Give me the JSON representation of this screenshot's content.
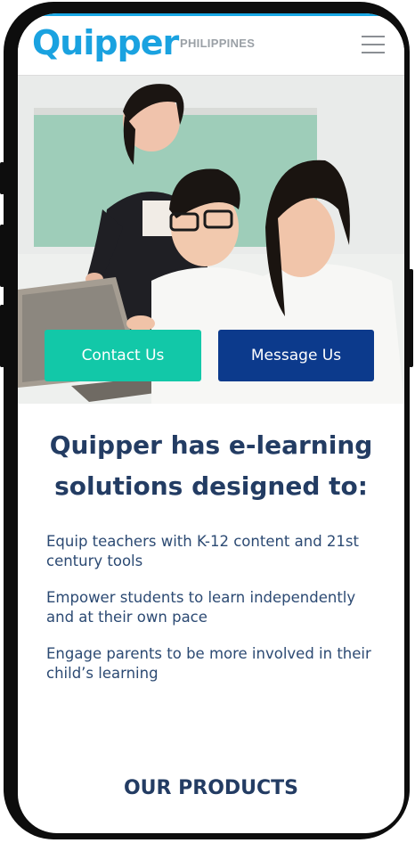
{
  "header": {
    "logo": "Quipper",
    "region": "PHILIPPINES",
    "menu_icon": "hamburger-menu-icon"
  },
  "hero": {
    "image_description_icon": "students-with-teacher-photo",
    "contact_label": "Contact Us",
    "message_label": "Message Us"
  },
  "intro": {
    "headline_line1": "Quipper has e-learning",
    "headline_line2": "solutions designed to:",
    "bullets": [
      "Equip teachers with K-12 content and 21st century tools",
      "Empower students to learn independently and at their own pace",
      "Engage parents to be more involved in their child’s learning"
    ]
  },
  "products": {
    "heading": "OUR PRODUCTS"
  },
  "colors": {
    "brand_blue": "#1aa2e0",
    "contact_green": "#12c8a8",
    "message_navy": "#0c3a8c",
    "heading_navy": "#233c63"
  }
}
